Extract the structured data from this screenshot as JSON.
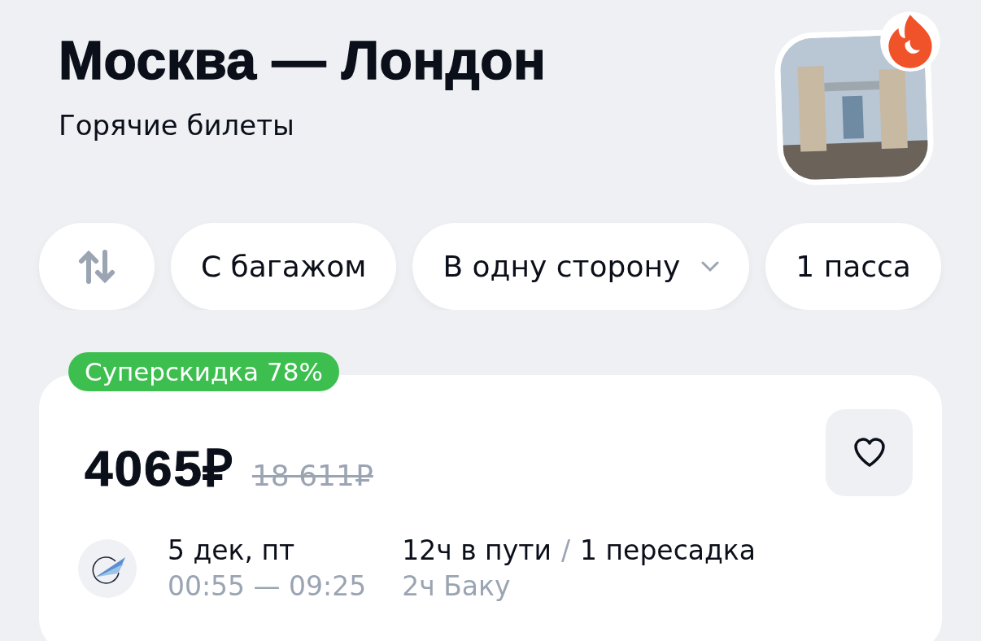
{
  "header": {
    "title": "Москва — Лондон",
    "subtitle": "Горячие билеты"
  },
  "filters": [
    {
      "kind": "swap"
    },
    {
      "kind": "chip",
      "label": "С багажом"
    },
    {
      "kind": "dropdown",
      "label": "В одну сторону"
    },
    {
      "kind": "chip",
      "label": "1 пасса"
    }
  ],
  "offer": {
    "badge": "Суперскидка 78%",
    "price": "4065₽",
    "old_price": "18 611₽",
    "flight": {
      "date": "5 дек, пт",
      "times": "00:55 — 09:25",
      "duration": "12ч в пути",
      "separator": "/",
      "stops": "1 пересадка",
      "layover": "2ч Баку"
    }
  }
}
